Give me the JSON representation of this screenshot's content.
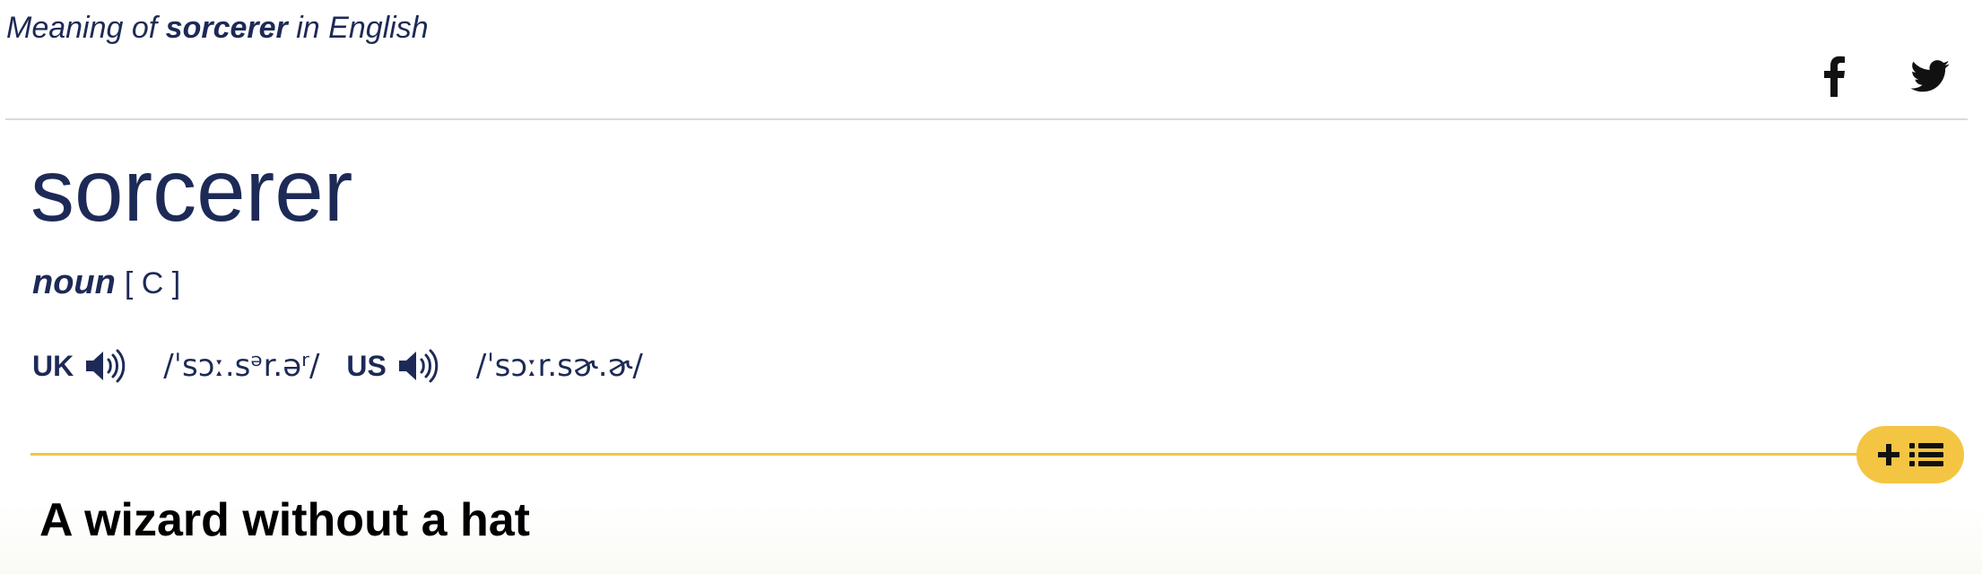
{
  "header": {
    "prefix": "Meaning of ",
    "headword": "sorcerer",
    "suffix": " in English"
  },
  "share": {
    "icons": [
      "facebook-icon",
      "twitter-icon"
    ]
  },
  "entry": {
    "headword": "sorcerer",
    "part_of_speech": "noun",
    "grammar_code": "[ C ]",
    "pronunciations": {
      "uk": {
        "label": "UK",
        "ipa": "/ˈsɔː.sᵊr.əʳ/"
      },
      "us": {
        "label": "US",
        "ipa": "/ˈsɔːr.sɚ.ɚ/"
      }
    }
  },
  "wordlist_button": {
    "icons": [
      "plus-icon",
      "list-icon"
    ]
  },
  "caption": "A wizard without a hat",
  "colors": {
    "navy": "#1d2a57",
    "accent_yellow": "#f4c542",
    "rule_gray": "#d9d9d9",
    "caption_text": "#000000"
  }
}
